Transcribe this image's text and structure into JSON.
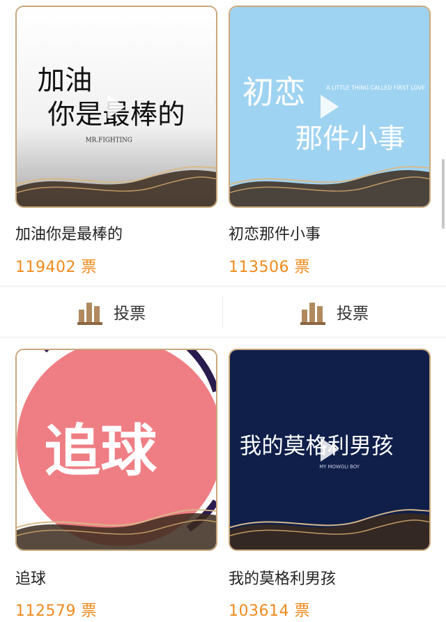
{
  "items": [
    {
      "title": "加油你是最棒的",
      "votes": "119402 票",
      "art_text_1": "加油",
      "art_text_2": "你是最棒的",
      "art_sub": "MR.FIGHTING",
      "bg": "#ffffff"
    },
    {
      "title": "初恋那件小事",
      "votes": "113506 票",
      "art_text_1": "初恋",
      "art_text_2": "那件小事",
      "art_sub": "A LITTLE THING CALLED FIRST LOVE",
      "bg": "#9fd3f2"
    },
    {
      "title": "追球",
      "votes": "112579 票",
      "art_text_1": "追球",
      "bg": "#ef7e84"
    },
    {
      "title": "我的莫格利男孩",
      "votes": "103614 票",
      "art_text_1": "我的莫格利男孩",
      "art_sub": "MY MOWGLI BOY",
      "bg": "#0f1f4a"
    }
  ],
  "vote_button": {
    "label": "投票",
    "icon": "bar-chart-icon"
  },
  "colors": {
    "accent": "#f08a1c",
    "frame": "#c9a77a"
  }
}
